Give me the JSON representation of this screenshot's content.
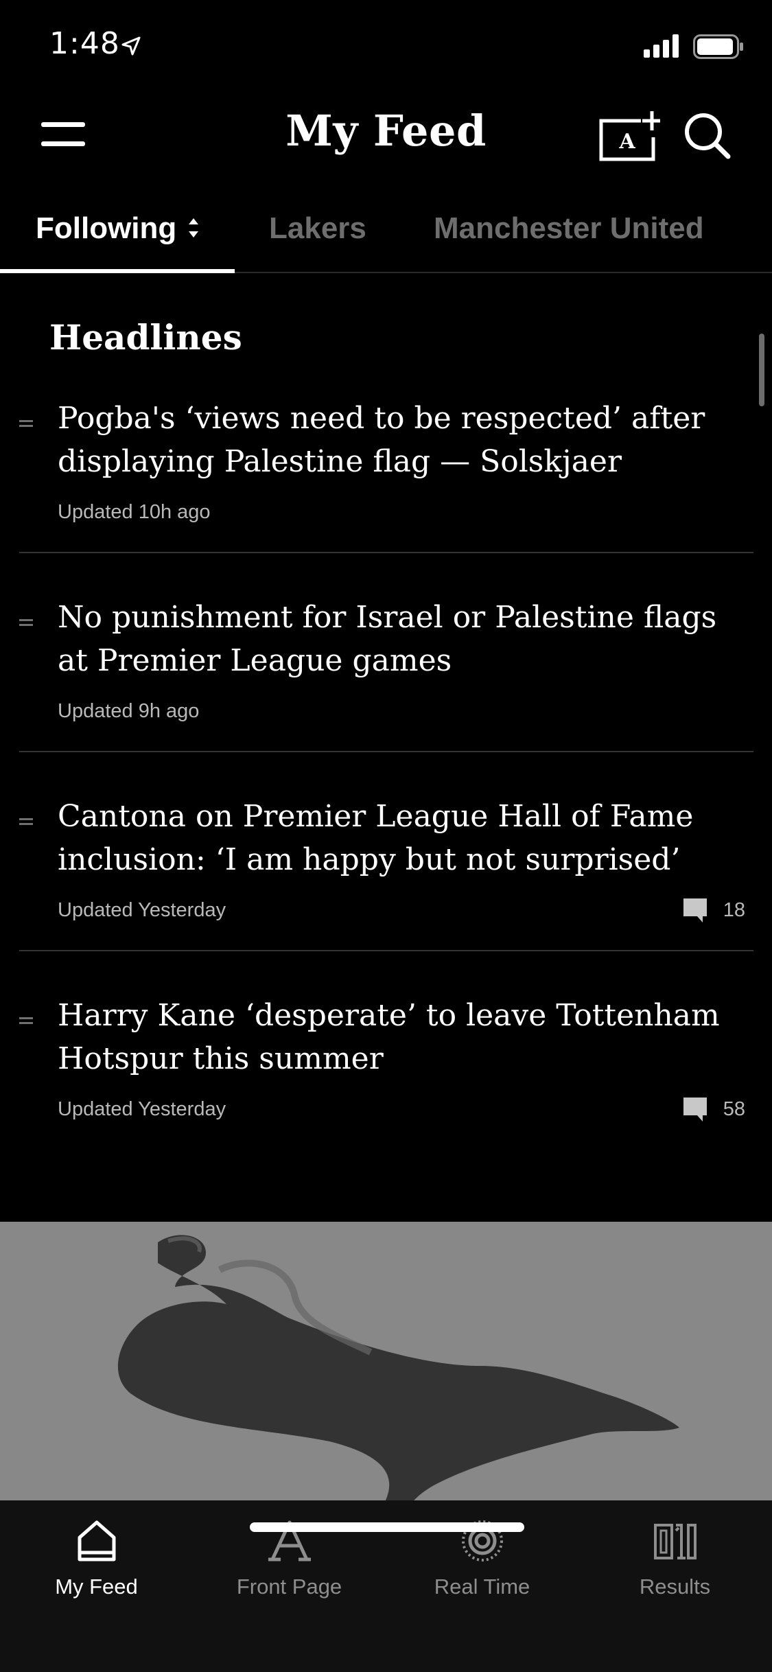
{
  "status_bar": {
    "time": "1:48"
  },
  "header": {
    "title": "My Feed",
    "icons": [
      "menu-icon",
      "add-team-icon",
      "search-icon"
    ],
    "add_team_letter": "A"
  },
  "tabs": [
    {
      "label": "Following",
      "active": true
    },
    {
      "label": "Lakers",
      "active": false
    },
    {
      "label": "Manchester United",
      "active": false
    }
  ],
  "section": {
    "title": "Headlines"
  },
  "articles": [
    {
      "headline": "Pogba's ‘views need to be respected’ after displaying Palestine flag — Solskjaer",
      "meta": "Updated 10h ago",
      "comments": ""
    },
    {
      "headline": "No punishment for Israel or Palestine flags at Premier League games",
      "meta": "Updated 9h ago",
      "comments": ""
    },
    {
      "headline": "Cantona on Premier League Hall of Fame inclusion: ‘I am happy but not surprised’",
      "meta": "Updated Yesterday",
      "comments": "18"
    },
    {
      "headline": "Harry Kane ‘desperate’ to leave Tottenham Hotspur this summer",
      "meta": "Updated Yesterday",
      "comments": "58"
    }
  ],
  "bottom_nav": [
    {
      "label": "My Feed",
      "icon": "home-icon",
      "active": true
    },
    {
      "label": "Front Page",
      "icon": "front-page-icon",
      "active": false
    },
    {
      "label": "Real Time",
      "icon": "real-time-icon",
      "active": false
    },
    {
      "label": "Results",
      "icon": "results-icon",
      "active": false
    }
  ],
  "colors": {
    "background": "#000000",
    "text": "#ffffff",
    "muted": "#6e6e6e",
    "meta": "#b9b9b9",
    "nav_bg": "#111111"
  }
}
